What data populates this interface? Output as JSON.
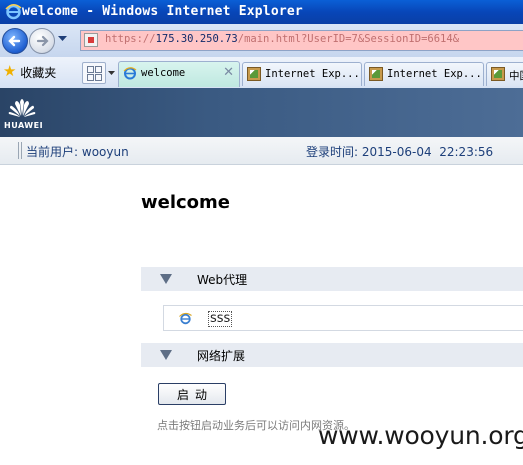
{
  "window": {
    "title": "welcome - Windows Internet Explorer"
  },
  "address": {
    "scheme": "https://",
    "host": "175.30.250.73",
    "path": "/main.html?UserID=7&SessionID=6614&"
  },
  "favorites": {
    "label": "收藏夹"
  },
  "tabs": [
    {
      "label": "welcome",
      "active": true,
      "icon": "ie-page-icon"
    },
    {
      "label": "Internet Exp...",
      "active": false,
      "icon": "image-page-icon"
    },
    {
      "label": "Internet Exp...",
      "active": false,
      "icon": "image-page-icon"
    },
    {
      "label": "中国",
      "active": false,
      "icon": "image-page-icon"
    }
  ],
  "brand": {
    "logo_text": "HUAWEI"
  },
  "infobar": {
    "user_label": "当前用户:",
    "user_value": "wooyun",
    "login_label": "登录时间:",
    "login_value": "2015-06-04  22:23:56"
  },
  "main": {
    "heading": "welcome",
    "sections": [
      {
        "title": "Web代理"
      },
      {
        "title": "网络扩展"
      }
    ],
    "resource": {
      "name": "sss"
    },
    "start_button": "启动",
    "hint": "点击按钮启动业务后可以访问内网资源。"
  },
  "watermark": "www.wooyun.org"
}
